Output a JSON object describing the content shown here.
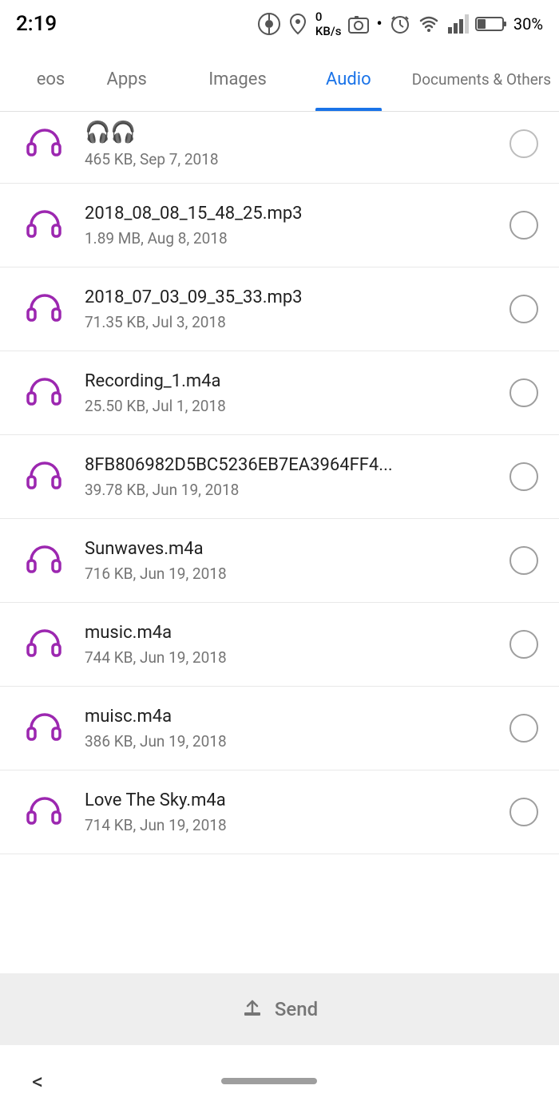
{
  "statusBar": {
    "time": "2:19",
    "batteryPercent": "30%"
  },
  "tabs": [
    {
      "id": "videos",
      "label": "eos",
      "active": false,
      "partial": true
    },
    {
      "id": "apps",
      "label": "Apps",
      "active": false
    },
    {
      "id": "images",
      "label": "Images",
      "active": false
    },
    {
      "id": "audio",
      "label": "Audio",
      "active": true
    },
    {
      "id": "documents",
      "label": "Documents & Others",
      "active": false
    }
  ],
  "files": [
    {
      "name": "",
      "meta": "465 KB, Sep 7, 2018",
      "partial": true
    },
    {
      "name": "2018_08_08_15_48_25.mp3",
      "meta": "1.89 MB, Aug 8, 2018"
    },
    {
      "name": "2018_07_03_09_35_33.mp3",
      "meta": "71.35 KB, Jul 3, 2018"
    },
    {
      "name": "Recording_1.m4a",
      "meta": "25.50 KB, Jul 1, 2018"
    },
    {
      "name": "8FB806982D5BC5236EB7EA3964FF4...",
      "meta": "39.78 KB, Jun 19, 2018"
    },
    {
      "name": "Sunwaves.m4a",
      "meta": "716 KB, Jun 19, 2018"
    },
    {
      "name": "music.m4a",
      "meta": "744 KB, Jun 19, 2018"
    },
    {
      "name": "muisc.m4a",
      "meta": "386 KB, Jun 19, 2018"
    },
    {
      "name": "Love The Sky.m4a",
      "meta": "714 KB, Jun 19, 2018"
    }
  ],
  "sendButton": {
    "label": "Send"
  },
  "navBar": {
    "backLabel": "<"
  }
}
